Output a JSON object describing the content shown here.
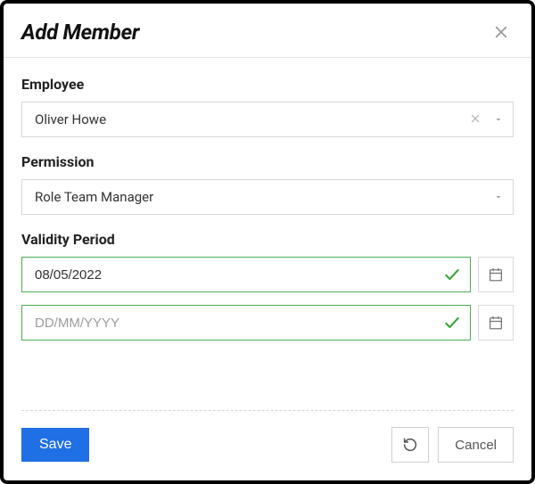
{
  "header": {
    "title": "Add Member"
  },
  "employee": {
    "label": "Employee",
    "value": "Oliver Howe"
  },
  "permission": {
    "label": "Permission",
    "value": "Role Team Manager"
  },
  "validity": {
    "label": "Validity Period",
    "start": "08/05/2022",
    "end": "",
    "placeholder": "DD/MM/YYYY"
  },
  "buttons": {
    "save": "Save",
    "cancel": "Cancel"
  }
}
